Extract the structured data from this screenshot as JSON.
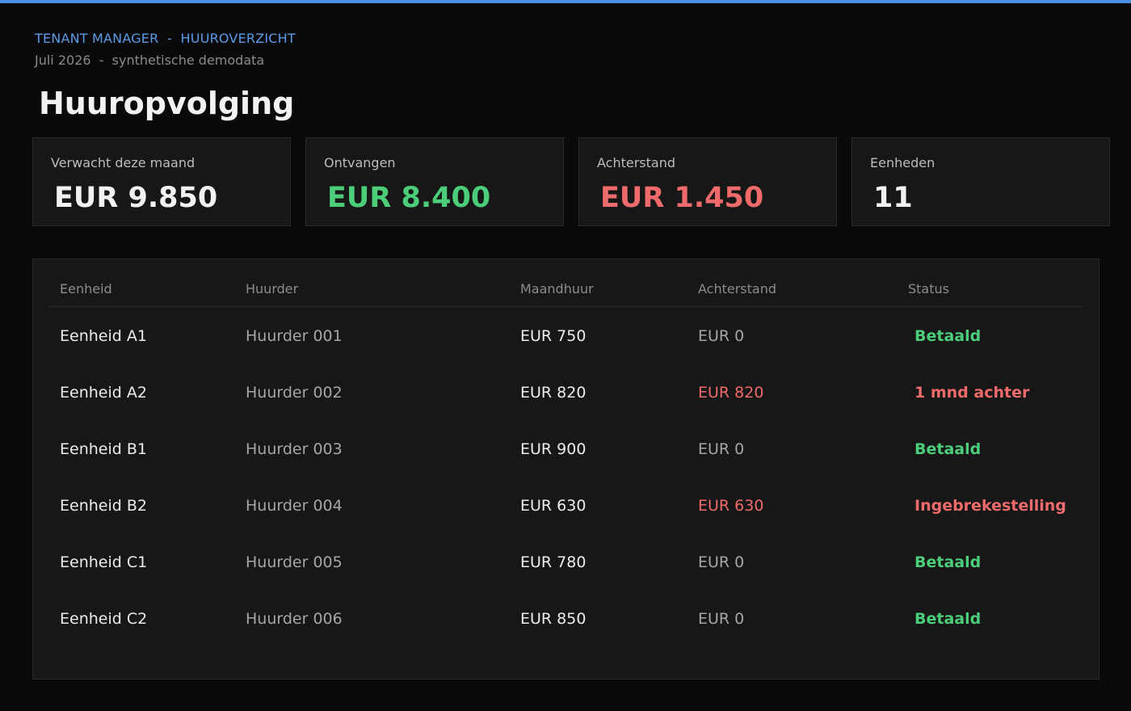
{
  "header": {
    "breadcrumb": "TENANT MANAGER  -  HUUROVERZICHT",
    "subtitle": "Juli 2026  -  synthetische demodata",
    "title": "Huuropvolging"
  },
  "colors": {
    "accent": "#4a8fe0",
    "positive": "#4ccd7a",
    "negative": "#ef6b6b",
    "neutral": "#f2f2f2"
  },
  "kpis": [
    {
      "label": "Verwacht deze maand",
      "value": "EUR 9.850",
      "tone": "neutral"
    },
    {
      "label": "Ontvangen",
      "value": "EUR 8.400",
      "tone": "good"
    },
    {
      "label": "Achterstand",
      "value": "EUR 1.450",
      "tone": "bad"
    },
    {
      "label": "Eenheden",
      "value": "11",
      "tone": "neutral"
    }
  ],
  "table": {
    "columns": [
      "Eenheid",
      "Huurder",
      "Maandhuur",
      "Achterstand",
      "Status"
    ],
    "rows": [
      {
        "unit": "Eenheid A1",
        "tenant": "Huurder 001",
        "rent": "EUR 750",
        "arrears": "EUR 0",
        "status": "Betaald",
        "tone": "good"
      },
      {
        "unit": "Eenheid A2",
        "tenant": "Huurder 002",
        "rent": "EUR 820",
        "arrears": "EUR 820",
        "status": "1 mnd achter",
        "tone": "bad"
      },
      {
        "unit": "Eenheid B1",
        "tenant": "Huurder 003",
        "rent": "EUR 900",
        "arrears": "EUR 0",
        "status": "Betaald",
        "tone": "good"
      },
      {
        "unit": "Eenheid B2",
        "tenant": "Huurder 004",
        "rent": "EUR 630",
        "arrears": "EUR 630",
        "status": "Ingebrekestelling",
        "tone": "bad"
      },
      {
        "unit": "Eenheid C1",
        "tenant": "Huurder 005",
        "rent": "EUR 780",
        "arrears": "EUR 0",
        "status": "Betaald",
        "tone": "good"
      },
      {
        "unit": "Eenheid C2",
        "tenant": "Huurder 006",
        "rent": "EUR 850",
        "arrears": "EUR 0",
        "status": "Betaald",
        "tone": "good"
      }
    ]
  }
}
